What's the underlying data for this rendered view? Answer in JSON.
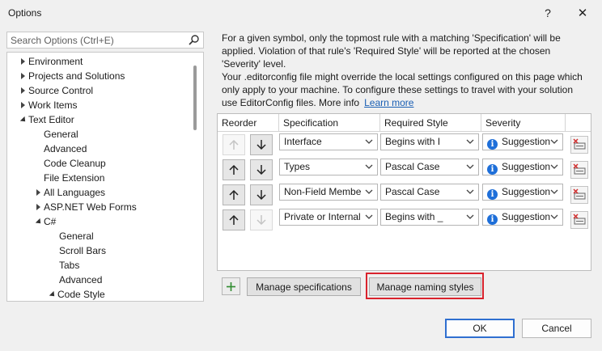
{
  "window": {
    "title": "Options",
    "help_label": "?",
    "close_label": "✕"
  },
  "search": {
    "placeholder": "Search Options (Ctrl+E)"
  },
  "tree": {
    "items": [
      {
        "label": "Environment",
        "state": "collapsed"
      },
      {
        "label": "Projects and Solutions",
        "state": "collapsed"
      },
      {
        "label": "Source Control",
        "state": "collapsed"
      },
      {
        "label": "Work Items",
        "state": "collapsed"
      },
      {
        "label": "Text Editor",
        "state": "expanded"
      },
      {
        "label": "General",
        "state": "leaf"
      },
      {
        "label": "Advanced",
        "state": "leaf"
      },
      {
        "label": "Code Cleanup",
        "state": "leaf"
      },
      {
        "label": "File Extension",
        "state": "leaf"
      },
      {
        "label": "All Languages",
        "state": "collapsed"
      },
      {
        "label": "ASP.NET Web Forms",
        "state": "collapsed"
      },
      {
        "label": "C#",
        "state": "expanded"
      },
      {
        "label": "General",
        "state": "leaf"
      },
      {
        "label": "Scroll Bars",
        "state": "leaf"
      },
      {
        "label": "Tabs",
        "state": "leaf"
      },
      {
        "label": "Advanced",
        "state": "leaf"
      },
      {
        "label": "Code Style",
        "state": "expanded"
      }
    ]
  },
  "description": {
    "para1": "For a given symbol, only the topmost rule with a matching 'Specification' will be applied. Violation of that rule's 'Required Style' will be reported at the chosen 'Severity' level.",
    "para2": "Your .editorconfig file might override the local settings configured on this page which only apply to your machine. To configure these settings to travel with your solution use EditorConfig files. More info",
    "learn_more": "Learn more"
  },
  "grid": {
    "headers": {
      "reorder": "Reorder",
      "specification": "Specification",
      "required_style": "Required Style",
      "severity": "Severity"
    },
    "rows": [
      {
        "specification": "Interface",
        "required_style": "Begins with I",
        "severity": "Suggestion",
        "up_enabled": false,
        "down_enabled": true
      },
      {
        "specification": "Types",
        "required_style": "Pascal Case",
        "severity": "Suggestion",
        "up_enabled": true,
        "down_enabled": true
      },
      {
        "specification": "Non-Field Members",
        "required_style": "Pascal Case",
        "severity": "Suggestion",
        "up_enabled": true,
        "down_enabled": true
      },
      {
        "specification": "Private or Internal",
        "required_style": "Begins with _",
        "severity": "Suggestion",
        "up_enabled": true,
        "down_enabled": false
      }
    ]
  },
  "buttons": {
    "add": "+",
    "manage_specifications": "Manage specifications",
    "manage_naming_styles": "Manage naming styles",
    "ok": "OK",
    "cancel": "Cancel"
  },
  "colors": {
    "accent": "#2f6fd0",
    "highlight": "#d9232d",
    "info_icon": "#1e6fd9"
  }
}
